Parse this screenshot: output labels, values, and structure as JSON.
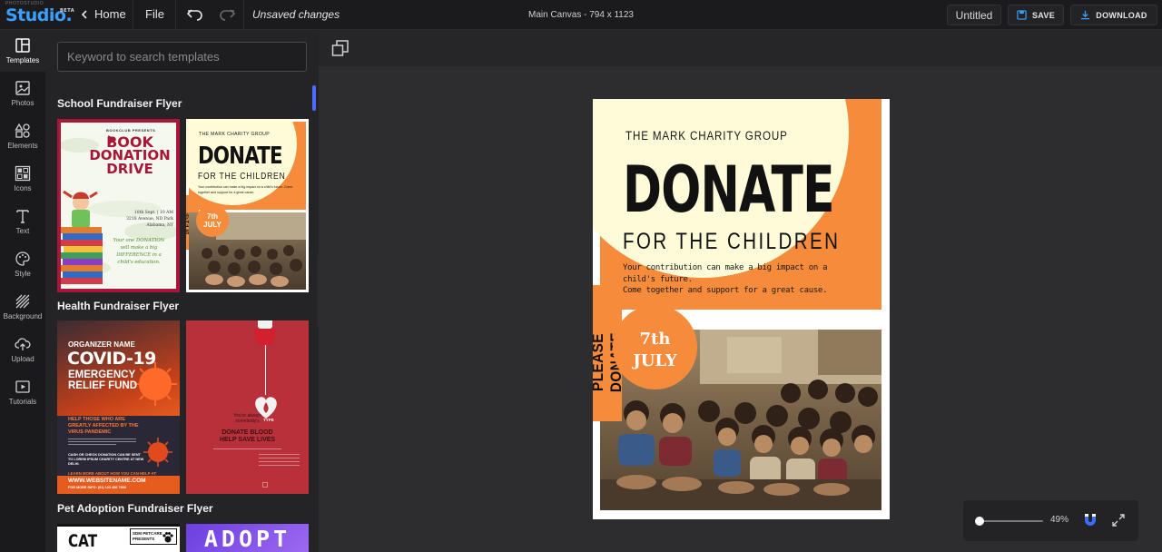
{
  "app": {
    "logo": "Studio",
    "logo_dot": ".",
    "beta": "BETA",
    "logo_sub": "PHOTOSTUDIO"
  },
  "topbar": {
    "home": "Home",
    "file": "File",
    "status": "Unsaved changes",
    "canvas_info": "Main Canvas - 794 x 1123",
    "doc_title": "Untitled",
    "save": "SAVE",
    "download": "DOWNLOAD"
  },
  "rail": [
    {
      "label": "Templates",
      "icon": "layout-icon"
    },
    {
      "label": "Photos",
      "icon": "image-icon"
    },
    {
      "label": "Elements",
      "icon": "shapes-icon"
    },
    {
      "label": "Icons",
      "icon": "icons-grid-icon"
    },
    {
      "label": "Text",
      "icon": "text-icon"
    },
    {
      "label": "Style",
      "icon": "palette-icon"
    },
    {
      "label": "Background",
      "icon": "pattern-icon"
    },
    {
      "label": "Upload",
      "icon": "upload-icon"
    },
    {
      "label": "Tutorials",
      "icon": "play-icon"
    }
  ],
  "panel": {
    "search_placeholder": "Keyword to search templates",
    "sections": [
      {
        "title": "School Fundraiser Flyer"
      },
      {
        "title": "Health Fundraiser Flyer"
      },
      {
        "title": "Pet Adoption Fundraiser Flyer"
      }
    ],
    "thumbs": {
      "book": {
        "presents": "BOOKCLUB PRESENTS",
        "line1": "BOOK",
        "line2": "DONATION",
        "line3": "DRIVE",
        "date": "10th Sept. | 10 AM",
        "addr1": "3218 Avenue, ND Park",
        "addr2": "Alabama, NY",
        "tag1": "Your one DONATION",
        "tag2": "will make a big",
        "tag3": "DIFFERENCE in a",
        "tag4": "child's education."
      },
      "donate": {
        "group": "THE MARK CHARITY GROUP",
        "title": "DONATE",
        "sub": "FOR THE CHILDREN",
        "body": "Your contribution can make a big impact on a child's future. Come together and support for a great cause.",
        "side": "PLEASE DONATE",
        "day": "7th",
        "month": "JULY"
      },
      "covid": {
        "org": "ORGANIZER NAME",
        "t1": "COVID-19",
        "t2": "EMERGENCY",
        "t3": "RELIEF FUND",
        "help1": "HELP THOSE WHO ARE",
        "help2": "GREATLY AFFECTED BY THE",
        "help3": "VIRUS PANDEMIC",
        "cash1": "CASH OR CHECK DONATION CAN BE SENT",
        "cash2": "TO LOREM IPSUM CHARITY CENTRE AT NEW",
        "cash3": "DELHI.",
        "learn": "LEARN MORE ABOUT HOW YOU CAN HELP AT:",
        "site": "WWW.WEBSITENAME.COM",
        "info": "FOR MORE INFO: (91) 123 456 7890"
      },
      "blood": {
        "line1": "You're always",
        "line2": "somebody's",
        "type": "TYPE",
        "h1": "DONATE BLOOD",
        "h2": "HELP SAVE LIVES"
      },
      "cat": {
        "word": "CAT",
        "shop1": "SDM PETCARE",
        "shop2": "PRESENTS"
      },
      "adopt": {
        "word": "ADOPT"
      }
    }
  },
  "canvas": {
    "group": "THE MARK CHARITY GROUP",
    "title": "DONATE",
    "sub": "FOR THE CHILDREN",
    "body1": "Your contribution can make a big impact on a",
    "body2": "child's future.",
    "body3": "Come together and support for a great cause.",
    "side": "PLEASE DONATE",
    "day": "7th",
    "month": "JULY"
  },
  "zoom": {
    "value": "49%",
    "level": 0.05
  },
  "colors": {
    "accent": "#3aa0ff",
    "orange": "#f68b3c",
    "cream": "#fdfbd8",
    "crimson": "#a4163a",
    "blood_red": "#b8313a",
    "covid_orange": "#e65b1e"
  }
}
